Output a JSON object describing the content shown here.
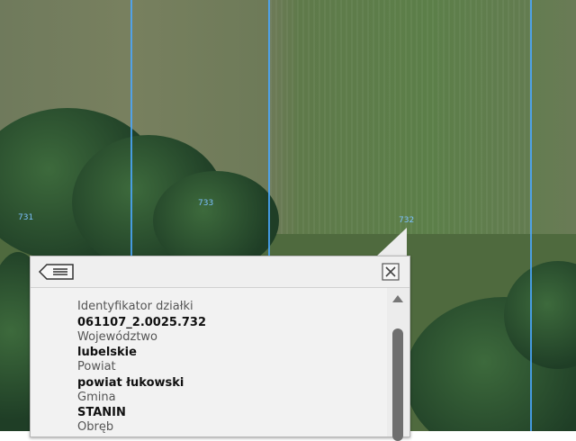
{
  "map": {
    "parcel_labels": [
      "731",
      "733",
      "732"
    ]
  },
  "popup": {
    "back_icon": "back-list-icon",
    "close_icon": "close-icon",
    "fields": [
      {
        "label": "Identyfikator działki",
        "value": "061107_2.0025.732"
      },
      {
        "label": "Województwo",
        "value": "lubelskie"
      },
      {
        "label": "Powiat",
        "value": "powiat łukowski"
      },
      {
        "label": "Gmina",
        "value": "STANIN"
      },
      {
        "label": "Obręb",
        "value": ""
      }
    ]
  }
}
